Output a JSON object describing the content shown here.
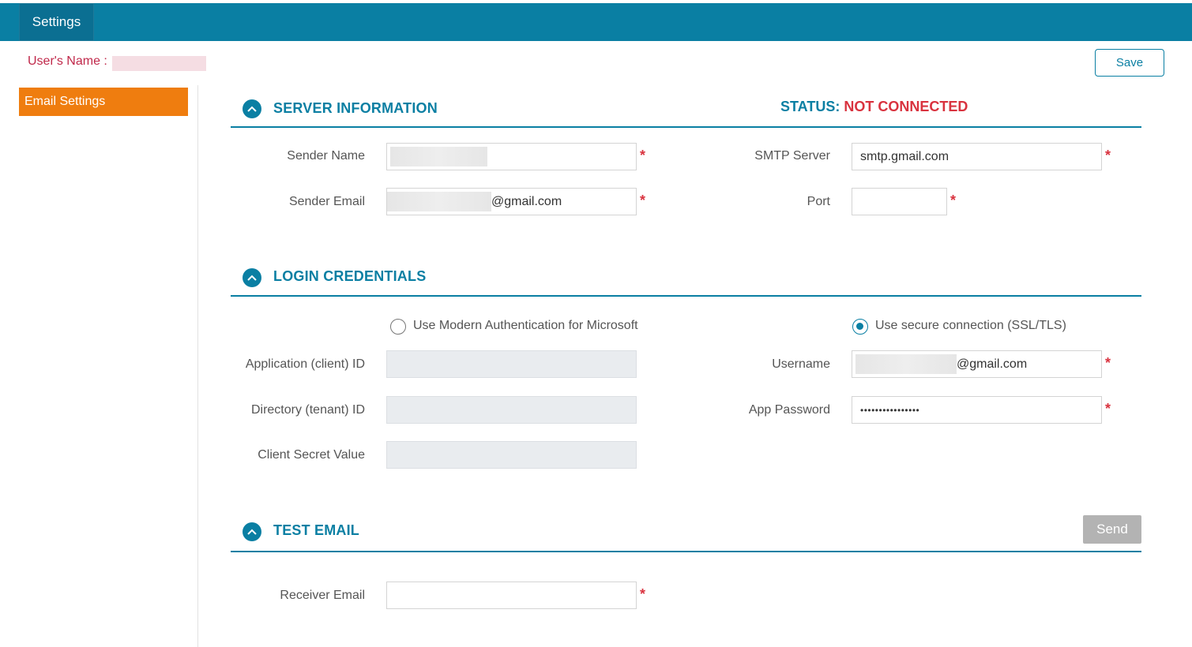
{
  "topbar": {
    "tab_label": "Settings"
  },
  "user": {
    "label": "User's Name :"
  },
  "toolbar": {
    "save_label": "Save"
  },
  "sidebar": {
    "items": [
      {
        "label": "Email Settings",
        "active": true
      }
    ]
  },
  "server": {
    "title": "SERVER INFORMATION",
    "status_key": "STATUS:",
    "status_value": "NOT CONNECTED",
    "sender_name_label": "Sender Name",
    "sender_email_label": "Sender Email",
    "sender_email_suffix": "@gmail.com",
    "smtp_label": "SMTP Server",
    "smtp_value": "smtp.gmail.com",
    "port_label": "Port"
  },
  "login": {
    "title": "LOGIN CREDENTIALS",
    "modern_auth_label": "Use Modern Authentication for Microsoft",
    "secure_label": "Use secure connection (SSL/TLS)",
    "app_id_label": "Application (client) ID",
    "dir_id_label": "Directory (tenant) ID",
    "secret_label": "Client Secret Value",
    "username_label": "Username",
    "username_suffix": "@gmail.com",
    "app_password_label": "App Password",
    "app_password_value": "••••••••••••••••"
  },
  "test": {
    "title": "TEST EMAIL",
    "send_label": "Send",
    "receiver_label": "Receiver Email"
  },
  "required_mark": "*",
  "colors": {
    "accent": "#0a7fa3",
    "orange": "#ef7d0f",
    "error": "#d9333f"
  }
}
